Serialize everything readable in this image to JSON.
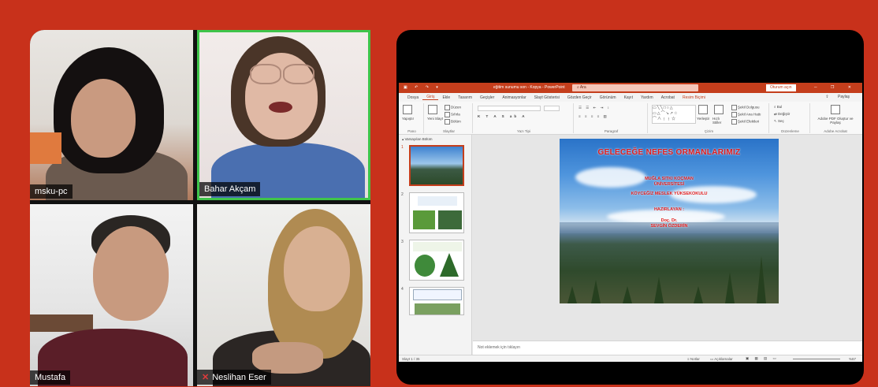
{
  "participants": [
    {
      "name": "msku-pc",
      "muted": false
    },
    {
      "name": "Bahar Akçam",
      "muted": false,
      "speaking": true
    },
    {
      "name": "Mustafa",
      "muted": false
    },
    {
      "name": "Neslihan Eser",
      "muted": true
    }
  ],
  "powerpoint": {
    "title": "eğitim sunumu son - Kopya - PowerPoint",
    "search_placeholder": "Ara",
    "signin_label": "Oturum açın",
    "tabs": [
      "Dosya",
      "Giriş",
      "Ekle",
      "Tasarım",
      "Geçişler",
      "Animasyonlar",
      "Slayt Gösterisi",
      "Gözden Geçir",
      "Görünüm",
      "Kayıt",
      "Yardım",
      "Acrobat",
      "Resim Biçimi"
    ],
    "active_tab": "Giriş",
    "share_label": "Paylaş",
    "ribbon_groups": {
      "pano": "Pano",
      "slaytlar": "Slaytlar",
      "yazi_tipi": "Yazı Tipi",
      "paragraf": "Paragraf",
      "cizim": "Çizim",
      "duzenleme": "Düzenleme",
      "adobe": "Adobe Acrobat"
    },
    "ribbon_buttons": {
      "yapistir": "Yapıştır",
      "yeni_slayt": "Yeni Slayt",
      "duzen": "Düzen",
      "sifirla": "Sıfırla",
      "bolum": "Bölüm",
      "yerlestir": "Yerleştir",
      "hizli_stiller": "Hızlı Stiller",
      "sekil_dolgusu": "Şekil Dolgusu",
      "sekil_ana_hatti": "Şekil Ana Hattı",
      "sekil_efektleri": "Şekil Efektleri",
      "bul": "Bul",
      "degistir": "Değiştir",
      "sec": "Seç",
      "adobe_pdf": "Adobe PDF Oluştur ve Paylaş"
    },
    "section_label": "Varsayılan Bölüm",
    "slide_numbers": [
      "1",
      "2",
      "3",
      "4"
    ],
    "slide": {
      "title": "GELECEĞE NEFES ORMANLARIMIZ",
      "line1": "MUĞLA SITKI KOÇMAN",
      "line2": "ÜNİVERSİTESİ",
      "line3": "KÖYCEĞİZ MESLEK YÜKSEKOKULU",
      "line4": "HAZIRLAYAN :",
      "line5": "Doç. Dr.",
      "line6": "SEVGİN ÖZDERİN"
    },
    "notes_placeholder": "Not eklemek için tıklayın",
    "status": {
      "slide_counter": "Slayt 1 / 35",
      "notes_button": "Notlar",
      "comments_button": "Açıklamalar",
      "zoom": "%67"
    }
  },
  "colors": {
    "background": "#c8311b",
    "office_accent": "#c43e1c",
    "speaking_border": "#3fc44a",
    "slide_title": "#e21a1a"
  }
}
